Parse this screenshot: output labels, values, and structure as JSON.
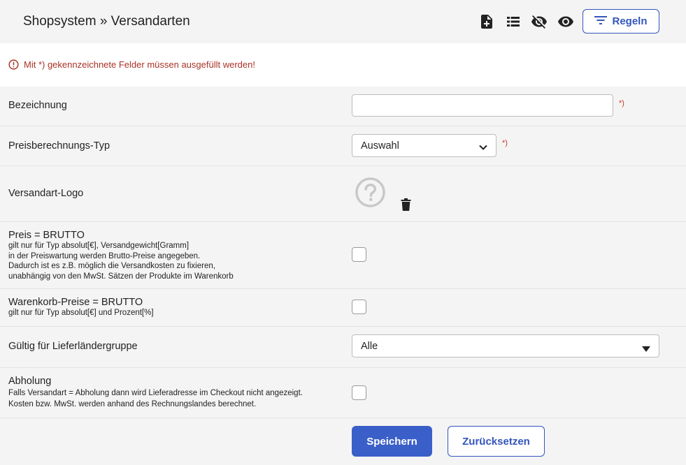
{
  "header": {
    "title": "Shopsystem » Versandarten",
    "icons": [
      "new-document-icon",
      "list-view-icon",
      "hide-icon",
      "show-icon",
      "filter-icon"
    ],
    "regeln_label": "Regeln"
  },
  "notice": {
    "icon": "info-circle-icon",
    "message": "Mit *) gekennzeichnete Felder müssen ausgefüllt werden!"
  },
  "form": {
    "required_marker": "*)",
    "bezeichnung": {
      "label": "Bezeichnung",
      "value": ""
    },
    "preistyp": {
      "label": "Preisberechnungs-Typ",
      "selected": "Auswahl"
    },
    "logo": {
      "label": "Versandart-Logo",
      "placeholder_icon": "question-circle-icon",
      "delete_icon": "trash-icon"
    },
    "brutto": {
      "label": "Preis = BRUTTO",
      "lines": [
        "gilt nur für Typ absolut[€], Versandgewicht[Gramm]",
        "in der Preiswartung werden Brutto-Preise angegeben.",
        "Dadurch ist es z.B. möglich die Versandkosten zu fixieren,",
        "unabhängig von den MwSt. Sätzen der Produkte im Warenkorb"
      ],
      "checked": false
    },
    "warenkorb": {
      "label": "Warenkorb-Preise = BRUTTO",
      "lines": [
        "gilt nur für Typ absolut[€] und Prozent[%]"
      ],
      "checked": false
    },
    "lieferland": {
      "label": "Gültig für Lieferländergruppe",
      "selected": "Alle"
    },
    "abholung": {
      "label": "Abholung",
      "lines": [
        "Falls Versandart = Abholung dann wird Lieferadresse im Checkout nicht angezeigt.",
        "Kosten bzw. MwSt. werden anhand des Rechnungslandes berechnet."
      ],
      "checked": false
    }
  },
  "actions": {
    "save_label": "Speichern",
    "reset_label": "Zurücksetzen"
  },
  "colors": {
    "accent": "#3a5fc8",
    "error": "#a93226",
    "background": "#f4f4f4"
  }
}
